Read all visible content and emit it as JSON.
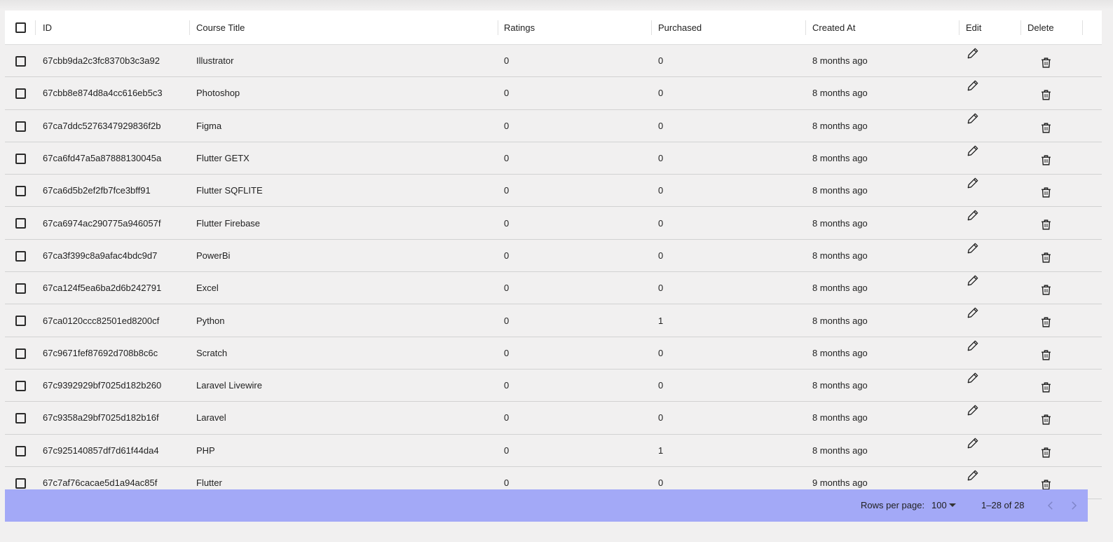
{
  "table": {
    "columns": {
      "id": "ID",
      "title": "Course Title",
      "ratings": "Ratings",
      "purchased": "Purchased",
      "created": "Created At",
      "edit": "Edit",
      "delete": "Delete"
    },
    "rows": [
      {
        "id": "67cbb9da2c3fc8370b3c3a92",
        "title": "Illustrator",
        "ratings": "0",
        "purchased": "0",
        "created": "8 months ago"
      },
      {
        "id": "67cbb8e874d8a4cc616eb5c3",
        "title": "Photoshop",
        "ratings": "0",
        "purchased": "0",
        "created": "8 months ago"
      },
      {
        "id": "67ca7ddc5276347929836f2b",
        "title": "Figma",
        "ratings": "0",
        "purchased": "0",
        "created": "8 months ago"
      },
      {
        "id": "67ca6fd47a5a87888130045a",
        "title": "Flutter GETX",
        "ratings": "0",
        "purchased": "0",
        "created": "8 months ago"
      },
      {
        "id": "67ca6d5b2ef2fb7fce3bff91",
        "title": "Flutter SQFLITE",
        "ratings": "0",
        "purchased": "0",
        "created": "8 months ago"
      },
      {
        "id": "67ca6974ac290775a946057f",
        "title": "Flutter Firebase",
        "ratings": "0",
        "purchased": "0",
        "created": "8 months ago"
      },
      {
        "id": "67ca3f399c8a9afac4bdc9d7",
        "title": "PowerBi",
        "ratings": "0",
        "purchased": "0",
        "created": "8 months ago"
      },
      {
        "id": "67ca124f5ea6ba2d6b242791",
        "title": "Excel",
        "ratings": "0",
        "purchased": "0",
        "created": "8 months ago"
      },
      {
        "id": "67ca0120ccc82501ed8200cf",
        "title": "Python",
        "ratings": "0",
        "purchased": "1",
        "created": "8 months ago"
      },
      {
        "id": "67c9671fef87692d708b8c6c",
        "title": "Scratch",
        "ratings": "0",
        "purchased": "0",
        "created": "8 months ago"
      },
      {
        "id": "67c9392929bf7025d182b260",
        "title": "Laravel Livewire",
        "ratings": "0",
        "purchased": "0",
        "created": "8 months ago"
      },
      {
        "id": "67c9358a29bf7025d182b16f",
        "title": "Laravel",
        "ratings": "0",
        "purchased": "0",
        "created": "8 months ago"
      },
      {
        "id": "67c925140857df7d61f44da4",
        "title": "PHP",
        "ratings": "0",
        "purchased": "1",
        "created": "8 months ago"
      },
      {
        "id": "67c7af76cacae5d1a94ac85f",
        "title": "Flutter",
        "ratings": "0",
        "purchased": "0",
        "created": "9 months ago"
      }
    ]
  },
  "footer": {
    "rows_per_page_label": "Rows per page:",
    "rows_per_page_value": "100",
    "range_text": "1–28 of 28"
  },
  "icons": {
    "edit": "pencil-icon",
    "delete": "trash-icon",
    "prev": "chevron-left-icon",
    "next": "chevron-right-icon",
    "caret": "caret-down-icon"
  },
  "colors": {
    "footer_bg": "#a3a9f7",
    "header_bg": "#ffffff",
    "row_bg": "#f1f0f0"
  }
}
